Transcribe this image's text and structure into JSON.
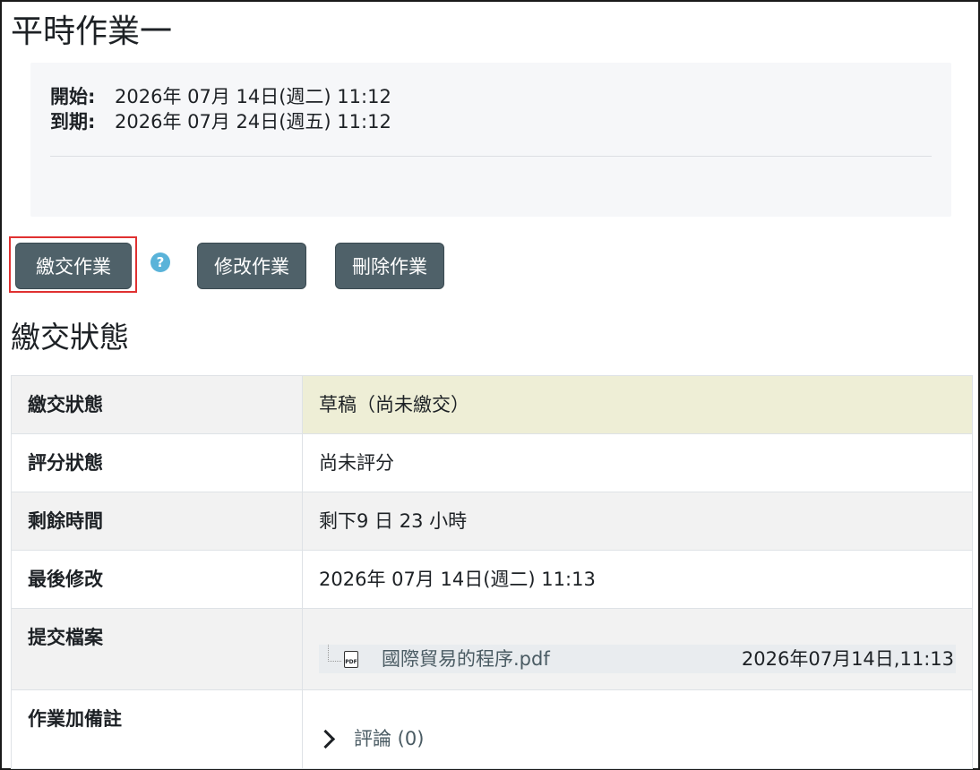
{
  "page_title": "平時作業一",
  "dates": {
    "open_label": "開始:",
    "open_value": "2026年 07月 14日(週二) 11:12",
    "due_label": "到期:",
    "due_value": "2026年 07月 24日(週五) 11:12"
  },
  "actions": {
    "submit": "繳交作業",
    "help_icon": "?",
    "edit": "修改作業",
    "remove": "刪除作業"
  },
  "section_title": "繳交狀態",
  "status_rows": [
    {
      "label": "繳交狀態",
      "value": "草稿（尚未繳交）"
    },
    {
      "label": "評分狀態",
      "value": "尚未評分"
    },
    {
      "label": "剩餘時間",
      "value": "剩下9 日 23 小時"
    },
    {
      "label": "最後修改",
      "value": "2026年 07月 14日(週二) 11:13"
    },
    {
      "label": "提交檔案",
      "file": {
        "icon": "PDF",
        "name": "國際貿易的程序.pdf",
        "date": "2026年07月14日,11:13"
      }
    },
    {
      "label": "作業加備註",
      "comment": "評論 (0)"
    }
  ],
  "colors": {
    "button": "#4f6169",
    "draft_bg": "#eeeed6",
    "highlight": "#e03131",
    "help": "#5ab3d9"
  }
}
